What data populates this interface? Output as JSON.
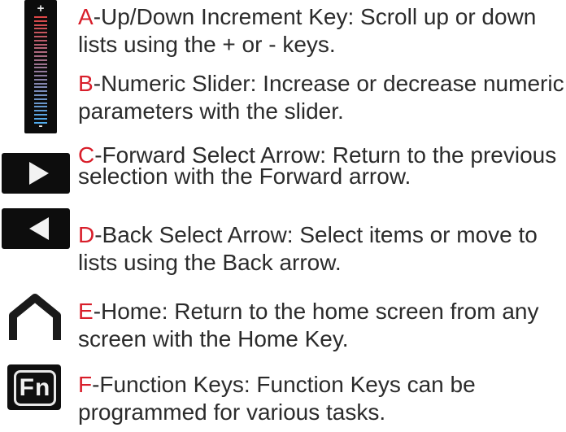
{
  "items": [
    {
      "letter": "A",
      "text": "-Up/Down Increment Key: Scroll up or down lists using the + or - keys."
    },
    {
      "letter": "B",
      "text": "-Numeric Slider: Increase or decrease numeric parameters with the slider."
    },
    {
      "letter": "C",
      "text": "-Forward Select Arrow: Return to the previous selection with the Forward arrow."
    },
    {
      "letter": "D",
      "text": "-Back Select Arrow: Select items or move to lists using the Back arrow."
    },
    {
      "letter": "E",
      "text": "-Home: Return to the home screen from any screen with the Home Key."
    },
    {
      "letter": "F",
      "text": "-Function Keys: Function Keys can be programmed for various tasks."
    }
  ],
  "icons": {
    "slider": {
      "name": "numeric-slider-icon",
      "plus": "+",
      "minus": "-"
    },
    "forward": {
      "name": "forward-arrow-icon"
    },
    "back": {
      "name": "back-arrow-icon"
    },
    "home": {
      "name": "home-icon"
    },
    "fn": {
      "name": "function-key-icon",
      "label": "Fn"
    }
  },
  "colors": {
    "accent": "#d81e2a",
    "text": "#2b2b2b",
    "icon_bg": "#0d0d0d"
  }
}
